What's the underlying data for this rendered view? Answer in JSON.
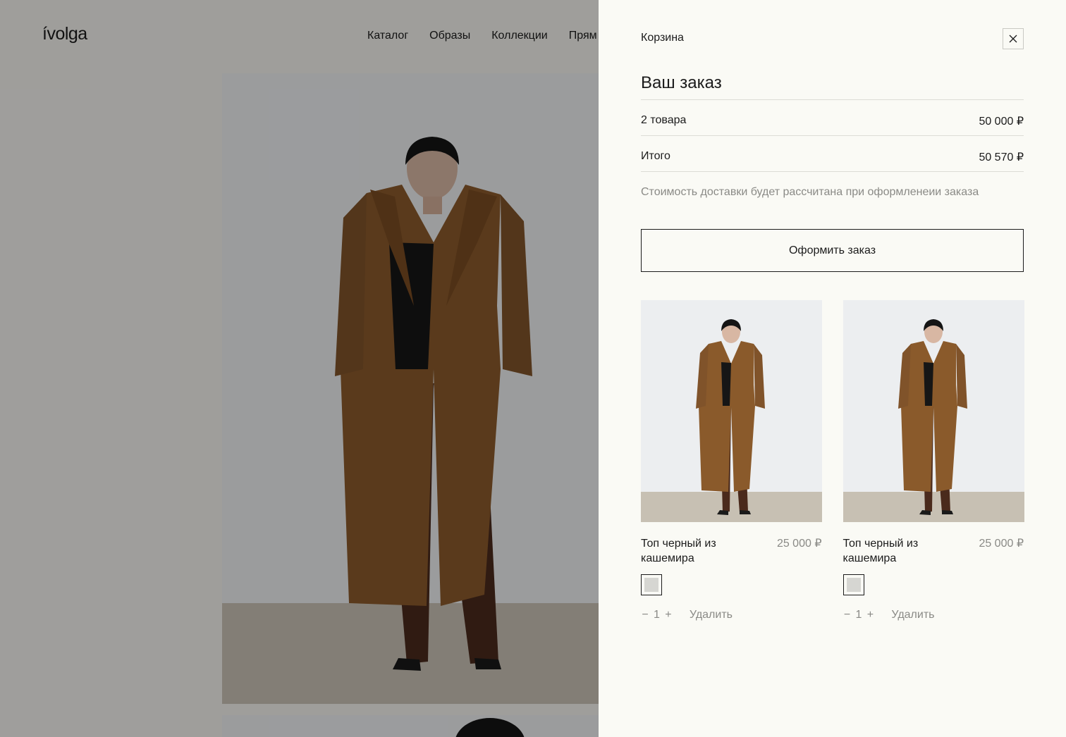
{
  "site": {
    "logo": "ívolga",
    "nav": [
      "Каталог",
      "Образы",
      "Коллекции",
      "Прям"
    ]
  },
  "cart": {
    "title": "Корзина",
    "close_icon": "close-icon",
    "heading": "Ваш заказ",
    "items_count_label": "2 товара",
    "items_sum": "50 000 ₽",
    "total_label": "Итого",
    "total_sum": "50 570 ₽",
    "delivery_note": "Стоимость доставки будет рассчитана при оформленеии заказа",
    "checkout_label": "Оформить заказ",
    "products": [
      {
        "name": "Топ черный из кашемира",
        "price": "25 000 ₽",
        "swatch_color": "#d6d6d2",
        "qty_minus": "−",
        "qty": "1",
        "qty_plus": "+",
        "remove_label": "Удалить"
      },
      {
        "name": "Топ черный из кашемира",
        "price": "25 000 ₽",
        "swatch_color": "#d6d6d2",
        "qty_minus": "−",
        "qty": "1",
        "qty_plus": "+",
        "remove_label": "Удалить"
      }
    ]
  },
  "colors": {
    "overlay": "rgba(0,0,0,0.35)",
    "drawer_bg": "#fafaf5",
    "coat": "#8a5a2b",
    "wall": "#eef0f2",
    "floor": "#c9c2b6"
  }
}
